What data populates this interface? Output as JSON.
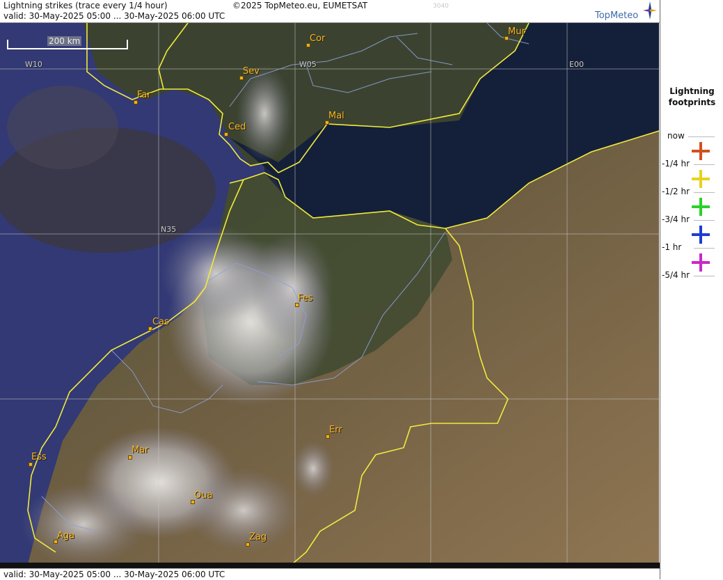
{
  "header": {
    "title": "Lightning strikes (trace every 1/4 hour)",
    "valid": "valid:  30-May-2025 05:00 ... 30-May-2025 06:00 UTC",
    "copyright": "©2025 TopMeteo.eu, EUMETSAT",
    "code": "3040",
    "logo": "TopMeteo",
    "logo_icon": "compass-star-icon"
  },
  "footer": {
    "valid": "valid:  30-May-2025 05:00 ... 30-May-2025 06:00 UTC"
  },
  "map": {
    "scale_label": "200 km",
    "grid_labels": {
      "w10": "W10",
      "w05": "W05",
      "e00": "E00",
      "n35": "N35"
    },
    "cities": {
      "cor": "Cor",
      "mur": "Mur",
      "sev": "Sev",
      "far": "Far",
      "ced": "Ced",
      "mal": "Mal",
      "fes": "Fes",
      "cas": "Cas",
      "err": "Err",
      "ess": "Ess",
      "mar": "Mar",
      "oua": "Oua",
      "aga": "Aga",
      "zag": "Zag"
    },
    "colors": {
      "border": "#f2ea3c",
      "rivers": "#8fa0d8",
      "city": "#f5b82a"
    }
  },
  "legend": {
    "title_line1": "Lightning",
    "title_line2": "footprints",
    "rows": [
      {
        "label": "now",
        "color": "#d2501e"
      },
      {
        "label": "-1/4 hr",
        "color": "#e6d21e"
      },
      {
        "label": "-1/2 hr",
        "color": "#28d228"
      },
      {
        "label": "-3/4 hr",
        "color": "#1e3cd2"
      },
      {
        "label": "-1 hr",
        "color": "#c828c8"
      },
      {
        "label": "-5/4 hr",
        "color": ""
      }
    ]
  }
}
